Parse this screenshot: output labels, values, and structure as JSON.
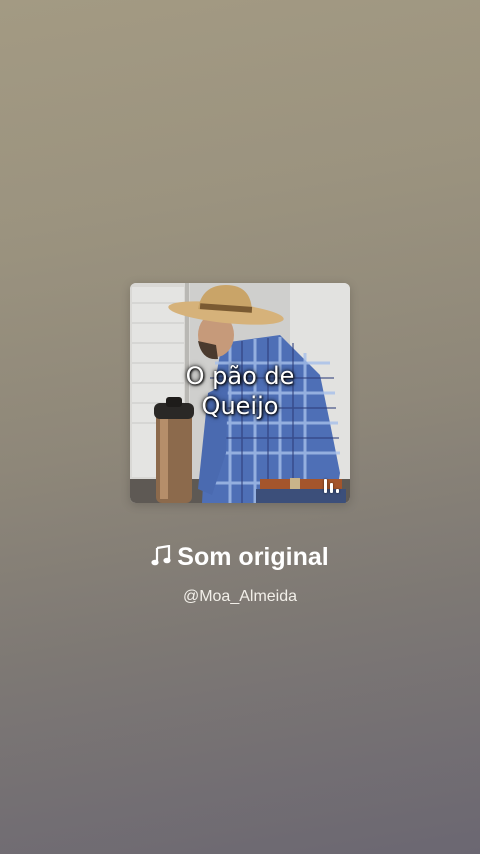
{
  "sound": {
    "cover_caption_line1": "O pão de",
    "cover_caption_line2": "Queijo",
    "title": "Som original",
    "author": "@Moa_Almeida"
  },
  "icons": {
    "title_icon": "music-note-icon",
    "cover_badge_icon": "pause-icon"
  },
  "colors": {
    "text": "#ffffff",
    "background_top": "#a39a83",
    "background_bottom": "#6b6772"
  }
}
